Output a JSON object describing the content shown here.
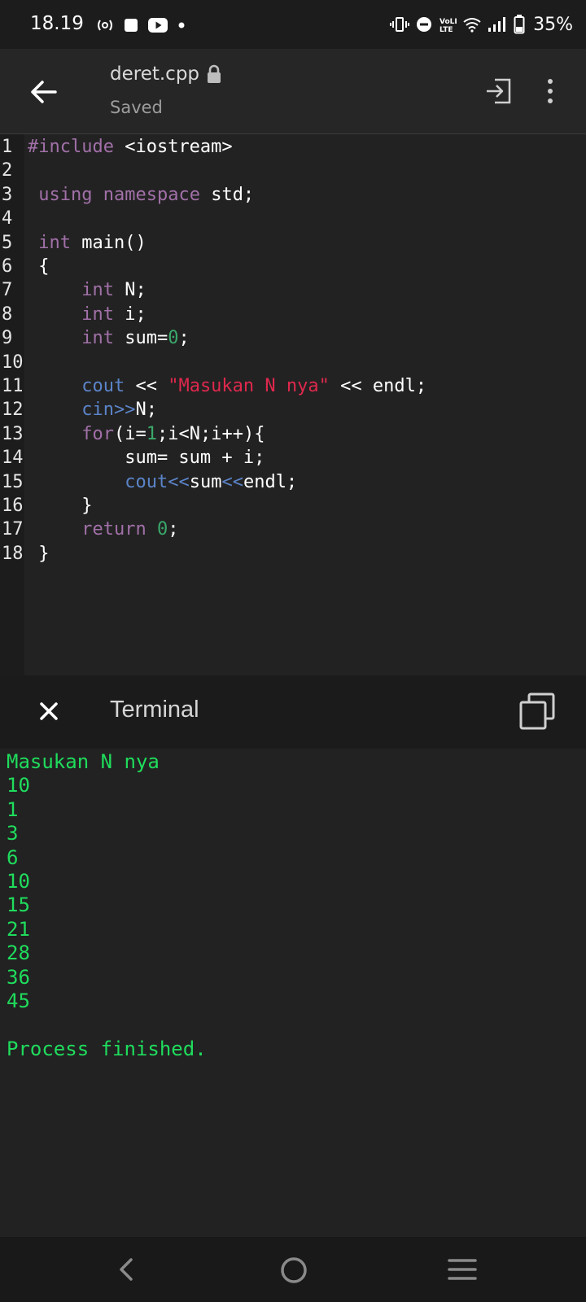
{
  "status_bar": {
    "time": "18.19",
    "battery": "35%",
    "icons": [
      "radio-icon",
      "notification-square-icon",
      "youtube-icon",
      "dot-icon",
      "vibrate-icon",
      "dnd-icon",
      "volte-icon",
      "wifi-icon",
      "signal-icon",
      "battery-icon"
    ]
  },
  "app_bar": {
    "title": "deret.cpp",
    "subtitle": "Saved",
    "icons": [
      "back-arrow-icon",
      "lock-icon",
      "run-icon",
      "more-vert-icon"
    ]
  },
  "editor": {
    "lines": [
      {
        "n": "1",
        "segs": [
          [
            "kw",
            "#include"
          ],
          [
            "",
            " <iostream>"
          ]
        ]
      },
      {
        "n": "2",
        "segs": []
      },
      {
        "n": "3",
        "segs": [
          [
            "",
            " "
          ],
          [
            "kw",
            "using"
          ],
          [
            "",
            " "
          ],
          [
            "kw",
            "namespace"
          ],
          [
            "",
            " std;"
          ]
        ]
      },
      {
        "n": "4",
        "segs": []
      },
      {
        "n": "5",
        "segs": [
          [
            "",
            " "
          ],
          [
            "kw",
            "int"
          ],
          [
            "",
            " main()"
          ]
        ]
      },
      {
        "n": "6",
        "segs": [
          [
            "",
            " {"
          ]
        ]
      },
      {
        "n": "7",
        "segs": [
          [
            "",
            "     "
          ],
          [
            "kw",
            "int"
          ],
          [
            "",
            " N;"
          ]
        ]
      },
      {
        "n": "8",
        "segs": [
          [
            "",
            "     "
          ],
          [
            "kw",
            "int"
          ],
          [
            "",
            " i;"
          ]
        ]
      },
      {
        "n": "9",
        "segs": [
          [
            "",
            "     "
          ],
          [
            "kw",
            "int"
          ],
          [
            "",
            " sum="
          ],
          [
            "num",
            "0"
          ],
          [
            "",
            ";"
          ]
        ]
      },
      {
        "n": "10",
        "segs": []
      },
      {
        "n": "11",
        "segs": [
          [
            "",
            "     "
          ],
          [
            "fn",
            "cout"
          ],
          [
            "",
            " << "
          ],
          [
            "str",
            "\"Masukan N nya\""
          ],
          [
            "",
            " << endl;"
          ]
        ]
      },
      {
        "n": "12",
        "segs": [
          [
            "",
            "     "
          ],
          [
            "fn",
            "cin>>"
          ],
          [
            "",
            "N;"
          ]
        ]
      },
      {
        "n": "13",
        "segs": [
          [
            "",
            "     "
          ],
          [
            "kw",
            "for"
          ],
          [
            "",
            "(i="
          ],
          [
            "num",
            "1"
          ],
          [
            "",
            ";i<N;i++){"
          ]
        ]
      },
      {
        "n": "14",
        "segs": [
          [
            "",
            "         sum= sum + i;"
          ]
        ]
      },
      {
        "n": "15",
        "segs": [
          [
            "",
            "         "
          ],
          [
            "fn",
            "cout<<"
          ],
          [
            "",
            "sum"
          ],
          [
            "fn",
            "<<"
          ],
          [
            "",
            "endl;"
          ]
        ]
      },
      {
        "n": "16",
        "segs": [
          [
            "",
            "     }"
          ]
        ]
      },
      {
        "n": "17",
        "segs": [
          [
            "",
            "     "
          ],
          [
            "kw",
            "return"
          ],
          [
            "",
            " "
          ],
          [
            "num",
            "0"
          ],
          [
            "",
            ";"
          ]
        ]
      },
      {
        "n": "18",
        "segs": [
          [
            "",
            " }"
          ]
        ]
      }
    ]
  },
  "terminal": {
    "title": "Terminal",
    "output": [
      "Masukan N nya",
      "10",
      "1",
      "3",
      "6",
      "10",
      "15",
      "21",
      "28",
      "36",
      "45",
      "",
      "Process finished."
    ]
  },
  "colors": {
    "keyword": "#a170a8",
    "function": "#5b84c9",
    "number": "#3aa86b",
    "string": "#e0284d",
    "terminal_text": "#1fdc5c"
  },
  "nav_bar": {
    "icons": [
      "nav-back-icon",
      "nav-home-icon",
      "nav-recent-icon"
    ]
  }
}
